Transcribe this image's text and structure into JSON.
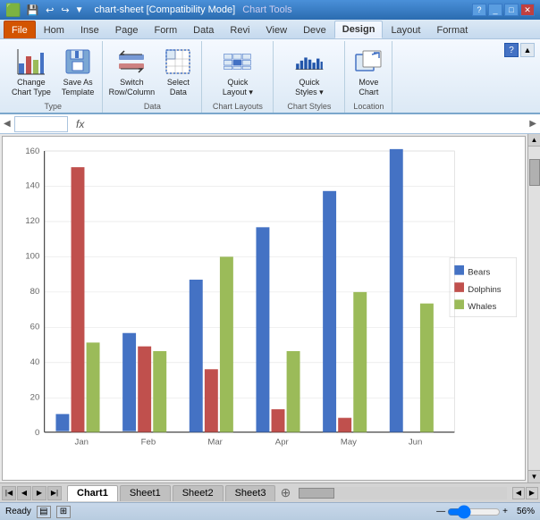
{
  "titleBar": {
    "title": "chart-sheet [Compatibility Mode]",
    "appTitle": "Chart Tools",
    "controls": [
      "minimize",
      "restore",
      "close"
    ]
  },
  "tabs": [
    {
      "id": "file",
      "label": "File"
    },
    {
      "id": "home",
      "label": "Hom"
    },
    {
      "id": "insert",
      "label": "Inse"
    },
    {
      "id": "page",
      "label": "Page"
    },
    {
      "id": "formulas",
      "label": "Form"
    },
    {
      "id": "data",
      "label": "Data"
    },
    {
      "id": "review",
      "label": "Revi"
    },
    {
      "id": "view",
      "label": "View"
    },
    {
      "id": "developer",
      "label": "Deve"
    },
    {
      "id": "design",
      "label": "Design",
      "active": true
    },
    {
      "id": "layout",
      "label": "Layout"
    },
    {
      "id": "format",
      "label": "Format"
    }
  ],
  "ribbon": {
    "groups": [
      {
        "id": "type",
        "label": "Type",
        "buttons": [
          {
            "id": "change-chart-type",
            "label": "Change\nChart Type",
            "icon": "chart-bar"
          },
          {
            "id": "save-as-template",
            "label": "Save As\nTemplate",
            "icon": "template"
          }
        ]
      },
      {
        "id": "data",
        "label": "Data",
        "buttons": [
          {
            "id": "switch-row-column",
            "label": "Switch\nRow/Column",
            "icon": "switch"
          },
          {
            "id": "select-data",
            "label": "Select\nData",
            "icon": "select-data"
          }
        ]
      },
      {
        "id": "chart-layouts",
        "label": "Chart Layouts",
        "buttons": [
          {
            "id": "quick-layout",
            "label": "Quick\nLayout ▾",
            "icon": "layout"
          }
        ]
      },
      {
        "id": "chart-styles",
        "label": "Chart Styles",
        "buttons": [
          {
            "id": "quick-styles",
            "label": "Quick\nStyles ▾",
            "icon": "styles"
          }
        ]
      },
      {
        "id": "location",
        "label": "Location",
        "buttons": [
          {
            "id": "move-chart",
            "label": "Move\nChart",
            "icon": "move"
          }
        ]
      }
    ]
  },
  "formulaBar": {
    "nameBox": "",
    "fx": "fx",
    "value": ""
  },
  "chart": {
    "title": "",
    "categories": [
      "Jan",
      "Feb",
      "Mar",
      "Apr",
      "May",
      "Jun"
    ],
    "series": [
      {
        "name": "Bears",
        "color": "#4472C4",
        "values": [
          10,
          55,
          85,
          115,
          135,
          158
        ]
      },
      {
        "name": "Dolphins",
        "color": "#C0504D",
        "values": [
          148,
          48,
          35,
          13,
          8,
          0
        ]
      },
      {
        "name": "Whales",
        "color": "#9BBB59",
        "values": [
          50,
          45,
          98,
          45,
          78,
          72
        ]
      }
    ],
    "yAxis": {
      "min": 0,
      "max": 160,
      "step": 20,
      "labels": [
        "0",
        "20",
        "40",
        "60",
        "80",
        "100",
        "120",
        "140",
        "160"
      ]
    },
    "legend": {
      "items": [
        "Bears",
        "Dolphins",
        "Whales"
      ]
    }
  },
  "sheetTabs": [
    {
      "id": "chart1",
      "label": "Chart1",
      "active": true
    },
    {
      "id": "sheet1",
      "label": "Sheet1"
    },
    {
      "id": "sheet2",
      "label": "Sheet2"
    },
    {
      "id": "sheet3",
      "label": "Sheet3"
    }
  ],
  "statusBar": {
    "ready": "Ready",
    "zoom": "56%"
  },
  "icons": {
    "chart-bar": "📊",
    "template": "💾",
    "switch": "⇄",
    "select-data": "📋",
    "layout": "▦",
    "styles": "🎨",
    "move": "↗"
  }
}
